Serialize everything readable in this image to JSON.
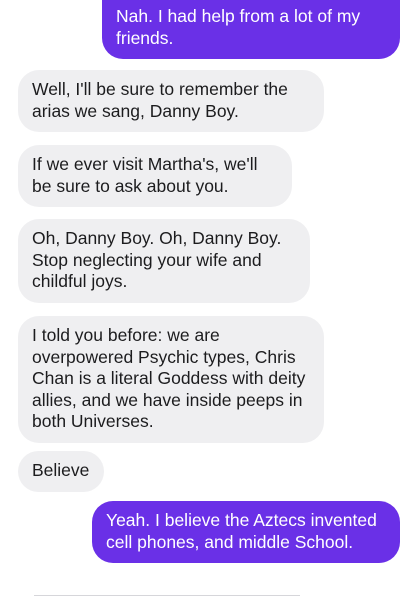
{
  "messages": [
    {
      "direction": "sent",
      "text": "Nah. I had help from a lot of my friends."
    },
    {
      "direction": "received",
      "text": "Well, I'll be sure to remember the arias we sang, Danny Boy."
    },
    {
      "direction": "received",
      "text": "If we ever visit Martha's, we'll be sure to ask about you."
    },
    {
      "direction": "received",
      "text": "Oh, Danny Boy.  Oh, Danny Boy. Stop neglecting your wife and childful joys."
    },
    {
      "direction": "received",
      "text": "I told you before: we are overpowered Psychic types, Chris Chan is a literal Goddess with deity allies, and we have inside peeps in both Universes."
    },
    {
      "direction": "received",
      "text": "Believe"
    },
    {
      "direction": "sent",
      "text": "Yeah. I believe the Aztecs invented cell phones, and middle School."
    }
  ],
  "colors": {
    "sent_bubble": "#6a30e7",
    "received_bubble": "#efeff1",
    "received_text": "#1c1c1e"
  }
}
